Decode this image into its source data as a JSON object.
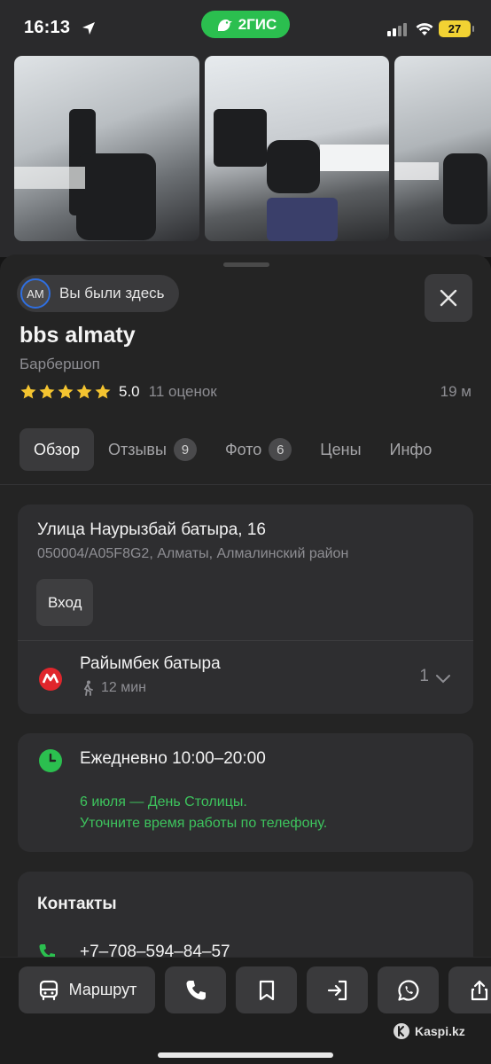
{
  "status_bar": {
    "time": "16:13",
    "brand": "2ГИС",
    "battery": "27"
  },
  "place": {
    "visited_avatar": "AM",
    "visited_label": "Вы были здесь",
    "title": "bbs almaty",
    "category": "Барбершоп",
    "rating": "5.0",
    "stars": 5,
    "reviews_count": "11 оценок",
    "distance": "19 м"
  },
  "tabs": [
    {
      "label": "Обзор",
      "active": true
    },
    {
      "label": "Отзывы",
      "badge": "9"
    },
    {
      "label": "Фото",
      "badge": "6"
    },
    {
      "label": "Цены"
    },
    {
      "label": "Инфо"
    }
  ],
  "address": {
    "street": "Улица Наурызбай батыра, 16",
    "details": "050004/A05F8G2, Алматы, Алмалинский район",
    "entrance_label": "Вход"
  },
  "metro": {
    "station": "Райымбек батыра",
    "walk_time": "12 мин",
    "count": "1"
  },
  "hours": {
    "schedule": "Ежедневно 10:00–20:00",
    "note_line1": "6 июля — День Столицы.",
    "note_line2": "Уточните время работы по телефону."
  },
  "contacts": {
    "title": "Контакты",
    "phone": "+7‒708‒594‒84‒57"
  },
  "bottom_bar": {
    "route_label": "Маршрут"
  },
  "watermark": "Kaspi.kz",
  "colors": {
    "brand_green": "#2bbf4f",
    "accent_green": "#3dc35d",
    "metro_red": "#e0262c",
    "star": "#f4c430"
  }
}
